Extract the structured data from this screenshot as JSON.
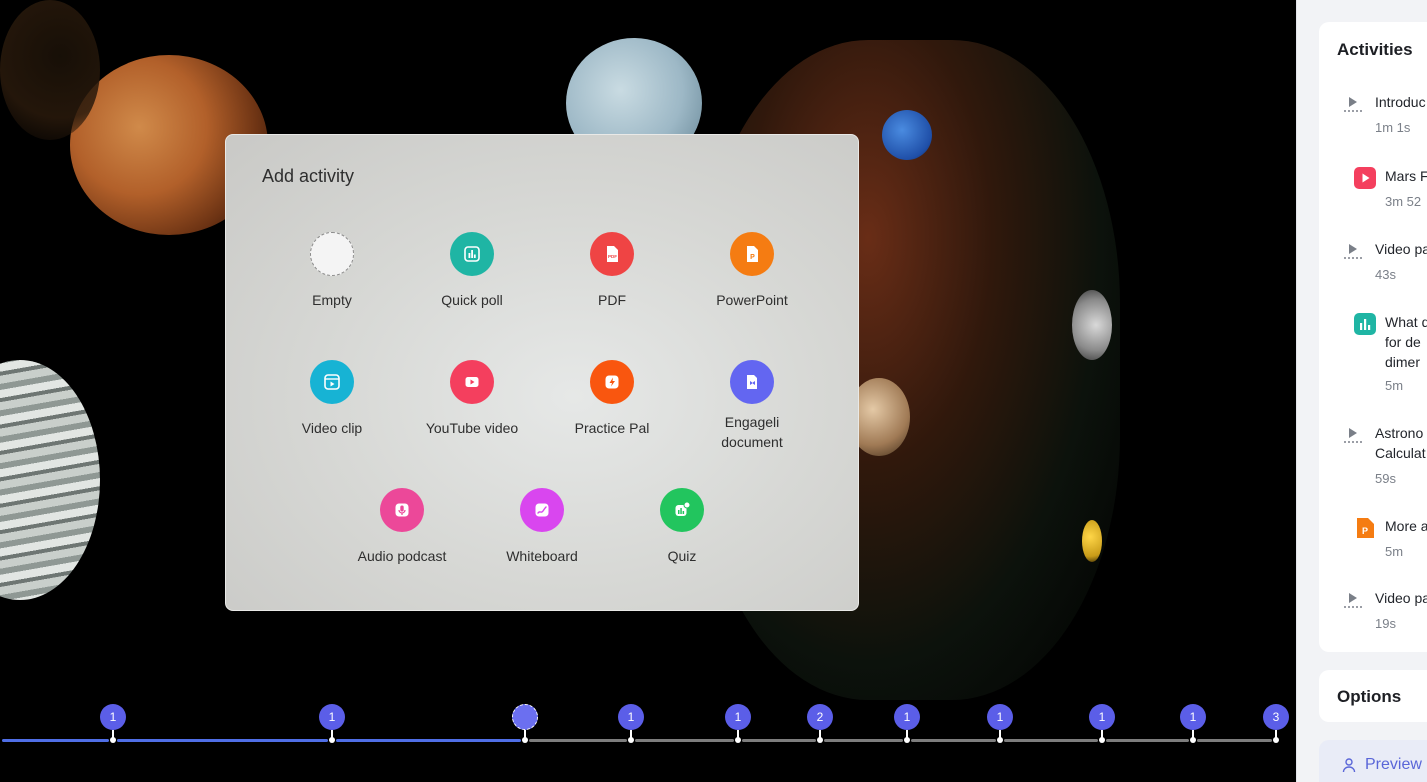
{
  "modal": {
    "title": "Add activity",
    "tiles": [
      {
        "label": "Empty",
        "icon": "empty-circle-icon"
      },
      {
        "label": "Quick poll",
        "icon": "poll-icon",
        "color": "#1fb5a4"
      },
      {
        "label": "PDF",
        "icon": "pdf-icon",
        "color": "#ef4444"
      },
      {
        "label": "PowerPoint",
        "icon": "powerpoint-icon",
        "color": "#f57c12"
      },
      {
        "label": "Video clip",
        "icon": "video-clip-icon",
        "color": "#17b3d4"
      },
      {
        "label": "YouTube video",
        "icon": "youtube-icon",
        "color": "#f43f5e"
      },
      {
        "label": "Practice Pal",
        "icon": "lightning-icon",
        "color": "#f9560f"
      },
      {
        "label_line1": "Engageli",
        "label_line2": "document",
        "icon": "document-icon",
        "color": "#6366f1"
      },
      {
        "label": "Audio podcast",
        "icon": "microphone-icon",
        "color": "#ec4899"
      },
      {
        "label": "Whiteboard",
        "icon": "whiteboard-icon",
        "color": "#d946ef"
      },
      {
        "label": "Quiz",
        "icon": "quiz-icon",
        "color": "#22c55e"
      }
    ]
  },
  "timeline": {
    "markers": [
      "1",
      "1",
      "",
      "1",
      "1",
      "2",
      "1",
      "1",
      "1",
      "1",
      "3"
    ],
    "done_color": "#4f6ee6",
    "todo_color": "#7d7d7d"
  },
  "sidebar": {
    "activities_title": "Activities",
    "activities": [
      {
        "title": "Introduc",
        "duration": "1m 1s",
        "icon": "video-pause-icon"
      },
      {
        "title": "Mars F",
        "duration": "3m 52",
        "icon": "youtube-icon",
        "color": "#f43f5e"
      },
      {
        "title": "Video pa",
        "duration": "43s",
        "icon": "video-pause-icon"
      },
      {
        "title_lines": [
          "What d",
          "for de",
          "dimer"
        ],
        "duration": "5m",
        "icon": "poll-icon",
        "color": "#1fb5a4"
      },
      {
        "title_lines": [
          "Astrono",
          "Calculat"
        ],
        "duration": "59s",
        "icon": "video-pause-icon"
      },
      {
        "title": "More a",
        "duration": "5m",
        "icon": "powerpoint-icon",
        "color": "#f57c12"
      },
      {
        "title": "Video pa",
        "duration": "19s",
        "icon": "video-pause-icon"
      }
    ],
    "options_title": "Options",
    "preview_label": "Preview"
  }
}
